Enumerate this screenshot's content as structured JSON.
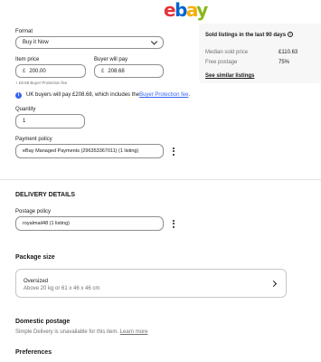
{
  "header": {
    "logo_letters": [
      "e",
      "b",
      "a",
      "y"
    ],
    "logo_colors": [
      "#e53238",
      "#0064d2",
      "#f5af02",
      "#86b817"
    ]
  },
  "form": {
    "format_label": "Format",
    "format_value": "Buy it Now",
    "item_price_label": "Item price",
    "item_price_currency": "£",
    "item_price_value": "200.00",
    "buyer_pays_label": "Buyer will pay",
    "buyer_pays_currency": "£",
    "buyer_pays_value": "208.68",
    "protection_fee_note": "+ £8.68 Buyer Protection fee",
    "info_text": "UK buyers will pay £208.68, which includes the ",
    "info_link": "Buyer Protection fee",
    "info_end": ".",
    "quantity_label": "Quantity",
    "quantity_value": "1",
    "payment_policy_label": "Payment policy",
    "payment_policy_value": "eBay Managed Payments (296353367011) (1 listing)"
  },
  "sold_panel": {
    "title": "Sold listings in the last 90 days",
    "info_icon": "i",
    "rows": [
      {
        "label": "Median sold price",
        "value": "£110.63"
      },
      {
        "label": "Free postage",
        "value": "75%"
      }
    ],
    "link": "See similar listings"
  },
  "delivery": {
    "heading": "DELIVERY DETAILS",
    "postage_policy_label": "Postage policy",
    "postage_policy_value": "royalmail48 (1 listing)",
    "package_size_heading": "Package size",
    "package_title": "Oversized",
    "package_desc": "Above 20 kg or 61 x 46 x 46 cm",
    "domestic_heading": "Domestic postage",
    "domestic_text": "Simple Delivery is unavailable for this item. ",
    "domestic_link": "Learn more",
    "preferences_heading": "Preferences"
  },
  "colors": {
    "accent": "#3665f3",
    "panel_bg": "#f7f7f7",
    "border": "#8f8f8f"
  }
}
